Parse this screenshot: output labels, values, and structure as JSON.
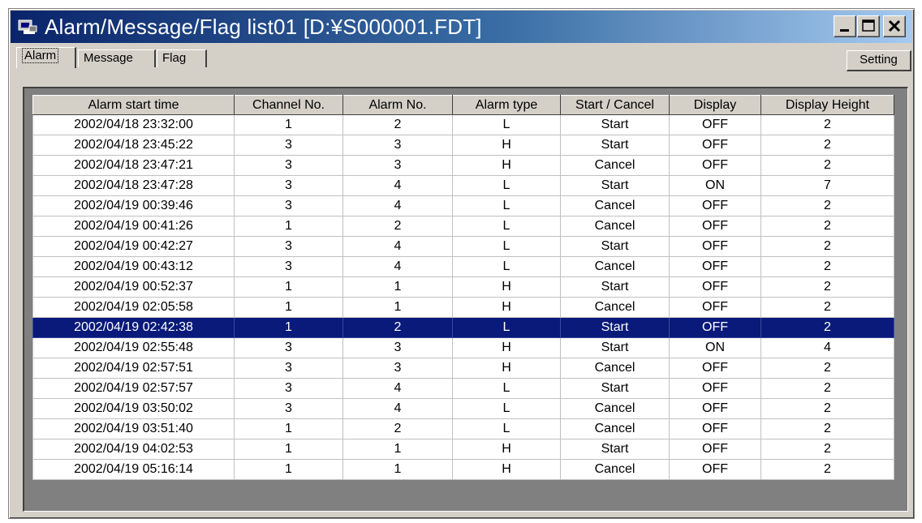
{
  "window": {
    "title": "Alarm/Message/Flag list01 [D:¥S000001.FDT]"
  },
  "tabs": [
    {
      "label": "Alarm"
    },
    {
      "label": "Message"
    },
    {
      "label": "Flag"
    }
  ],
  "setting_label": "Setting",
  "table": {
    "headers": [
      "Alarm start time",
      "Channel No.",
      "Alarm No.",
      "Alarm type",
      "Start / Cancel",
      "Display",
      "Display Height"
    ],
    "rows": [
      [
        "2002/04/18 23:32:00",
        "1",
        "2",
        "L",
        "Start",
        "OFF",
        "2"
      ],
      [
        "2002/04/18 23:45:22",
        "3",
        "3",
        "H",
        "Start",
        "OFF",
        "2"
      ],
      [
        "2002/04/18 23:47:21",
        "3",
        "3",
        "H",
        "Cancel",
        "OFF",
        "2"
      ],
      [
        "2002/04/18 23:47:28",
        "3",
        "4",
        "L",
        "Start",
        "ON",
        "7"
      ],
      [
        "2002/04/19 00:39:46",
        "3",
        "4",
        "L",
        "Cancel",
        "OFF",
        "2"
      ],
      [
        "2002/04/19 00:41:26",
        "1",
        "2",
        "L",
        "Cancel",
        "OFF",
        "2"
      ],
      [
        "2002/04/19 00:42:27",
        "3",
        "4",
        "L",
        "Start",
        "OFF",
        "2"
      ],
      [
        "2002/04/19 00:43:12",
        "3",
        "4",
        "L",
        "Cancel",
        "OFF",
        "2"
      ],
      [
        "2002/04/19 00:52:37",
        "1",
        "1",
        "H",
        "Start",
        "OFF",
        "2"
      ],
      [
        "2002/04/19 02:05:58",
        "1",
        "1",
        "H",
        "Cancel",
        "OFF",
        "2"
      ],
      [
        "2002/04/19 02:42:38",
        "1",
        "2",
        "L",
        "Start",
        "OFF",
        "2"
      ],
      [
        "2002/04/19 02:55:48",
        "3",
        "3",
        "H",
        "Start",
        "ON",
        "4"
      ],
      [
        "2002/04/19 02:57:51",
        "3",
        "3",
        "H",
        "Cancel",
        "OFF",
        "2"
      ],
      [
        "2002/04/19 02:57:57",
        "3",
        "4",
        "L",
        "Start",
        "OFF",
        "2"
      ],
      [
        "2002/04/19 03:50:02",
        "3",
        "4",
        "L",
        "Cancel",
        "OFF",
        "2"
      ],
      [
        "2002/04/19 03:51:40",
        "1",
        "2",
        "L",
        "Cancel",
        "OFF",
        "2"
      ],
      [
        "2002/04/19 04:02:53",
        "1",
        "1",
        "H",
        "Start",
        "OFF",
        "2"
      ],
      [
        "2002/04/19 05:16:14",
        "1",
        "1",
        "H",
        "Cancel",
        "OFF",
        "2"
      ]
    ],
    "selected_row": 10
  },
  "colors": {
    "title_bar_start": "#0a246a",
    "title_bar_end": "#a6caf0",
    "selection": "#0a1a7a",
    "face": "#d4d0c8"
  },
  "icons": [
    "app-icon",
    "minimize-icon",
    "maximize-icon",
    "close-icon"
  ]
}
